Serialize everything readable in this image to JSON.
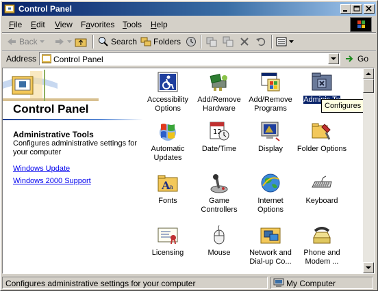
{
  "window": {
    "title": "Control Panel"
  },
  "menu": [
    "File",
    "Edit",
    "View",
    "Favorites",
    "Tools",
    "Help"
  ],
  "menu_underline": [
    "F",
    "E",
    "V",
    "a",
    "T",
    "H"
  ],
  "toolbar": {
    "back": "Back",
    "search": "Search",
    "folders": "Folders"
  },
  "address": {
    "label": "Address",
    "value": "Control Panel",
    "go": "Go"
  },
  "left_pane": {
    "title": "Control Panel",
    "info_title": "Administrative Tools",
    "info_desc": "Configures administrative settings for your computer",
    "links": [
      "Windows Update",
      "Windows 2000 Support"
    ]
  },
  "items": [
    {
      "label": "Accessibility Options",
      "icon": "accessibility-icon"
    },
    {
      "label": "Add/Remove Hardware",
      "icon": "hardware-icon"
    },
    {
      "label": "Add/Remove Programs",
      "icon": "programs-icon"
    },
    {
      "label": "Administrative Tools",
      "icon": "admin-tools-icon"
    },
    {
      "label": "Automatic Updates",
      "icon": "windows-flag-icon"
    },
    {
      "label": "Date/Time",
      "icon": "calendar-clock-icon"
    },
    {
      "label": "Display",
      "icon": "monitor-icon"
    },
    {
      "label": "Folder Options",
      "icon": "folder-options-icon"
    },
    {
      "label": "Fonts",
      "icon": "fonts-folder-icon"
    },
    {
      "label": "Game Controllers",
      "icon": "joystick-icon"
    },
    {
      "label": "Internet Options",
      "icon": "globe-icon"
    },
    {
      "label": "Keyboard",
      "icon": "keyboard-icon"
    },
    {
      "label": "Licensing",
      "icon": "certificate-icon"
    },
    {
      "label": "Mouse",
      "icon": "mouse-icon"
    },
    {
      "label": "Network and Dial-up Co...",
      "icon": "network-icon"
    },
    {
      "label": "Phone and Modem ...",
      "icon": "phone-icon"
    }
  ],
  "selected_item_label": "Adminis Te",
  "tooltip": "Configures admi",
  "status": {
    "text": "Configures administrative settings for your computer",
    "zone": "My Computer"
  }
}
